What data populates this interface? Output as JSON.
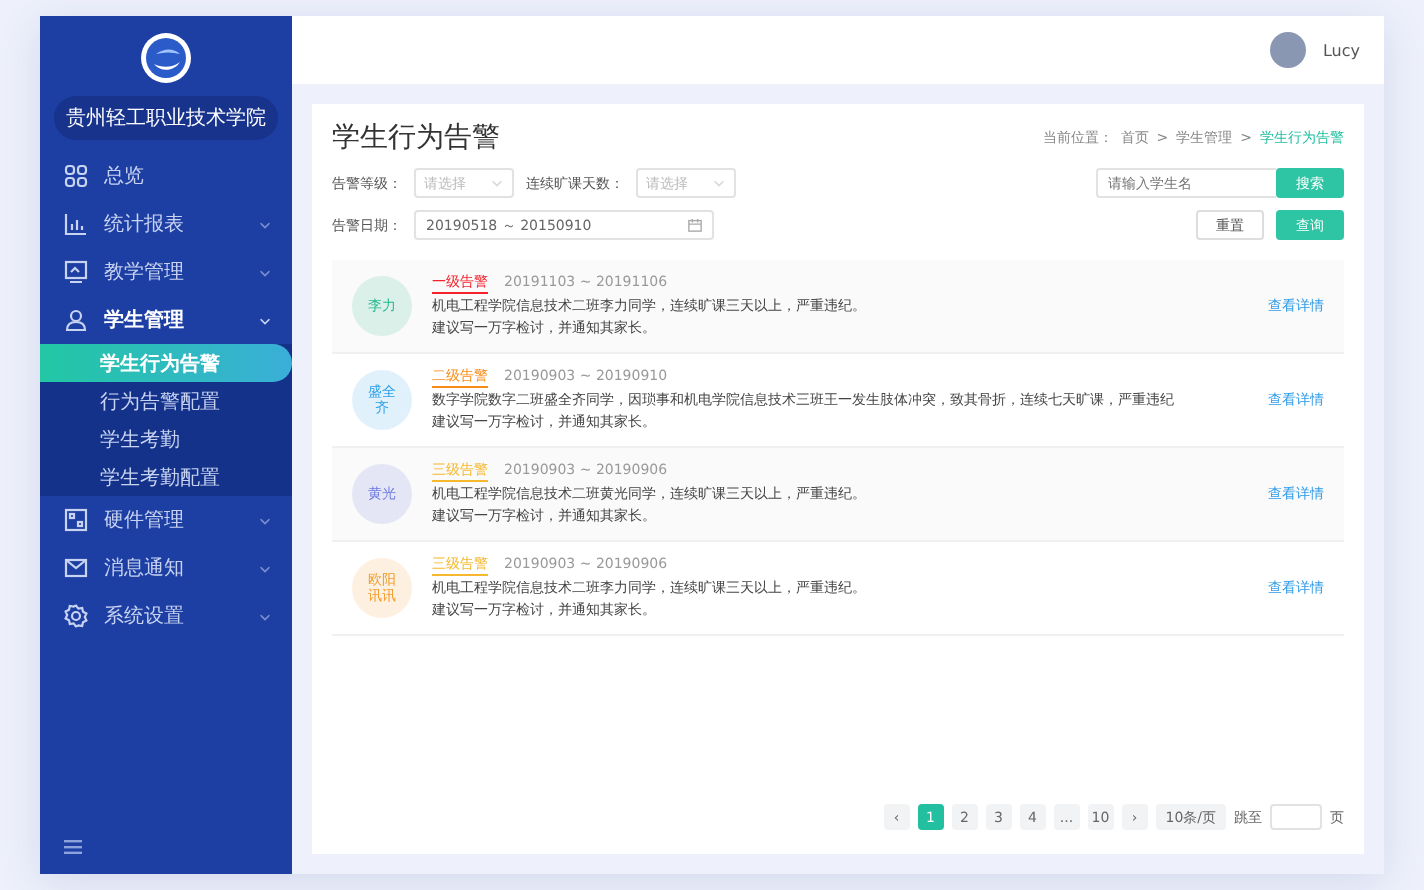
{
  "sidebar": {
    "school_name": "贵州轻工职业技术学院",
    "items": [
      {
        "label": "总览",
        "kind": "overview",
        "selected": false
      },
      {
        "label": "统计报表",
        "kind": "stats",
        "selected": false,
        "expanded": false
      },
      {
        "label": "教学管理",
        "kind": "teaching",
        "selected": false,
        "expanded": false
      },
      {
        "label": "学生管理",
        "kind": "students",
        "selected": false,
        "expanded": true,
        "children": [
          {
            "label": "学生行为告警",
            "selected": true
          },
          {
            "label": "行为告警配置",
            "selected": false
          },
          {
            "label": "学生考勤",
            "selected": false
          },
          {
            "label": "学生考勤配置",
            "selected": false
          }
        ]
      },
      {
        "label": "硬件管理",
        "kind": "hardware",
        "selected": false,
        "expanded": false
      },
      {
        "label": "消息通知",
        "kind": "messages",
        "selected": false,
        "expanded": false
      },
      {
        "label": "系统设置",
        "kind": "settings",
        "selected": false,
        "expanded": false
      }
    ]
  },
  "header": {
    "user_name": "Lucy"
  },
  "page": {
    "title": "学生行为告警",
    "breadcrumb": {
      "label": "当前位置：",
      "separator": ">",
      "items": [
        {
          "label": "首页",
          "selected": false
        },
        {
          "label": "学生管理",
          "selected": false
        },
        {
          "label": "学生行为告警",
          "selected": true
        }
      ]
    },
    "filters": {
      "level": {
        "label": "告警等级：",
        "placeholder": "请选择"
      },
      "days": {
        "label": "连续旷课天数：",
        "placeholder": "请选择"
      },
      "search": {
        "placeholder": "请输入学生名",
        "button": "搜索"
      },
      "date": {
        "label": "告警日期：",
        "value": "20190518 ～ 20150910"
      },
      "reset_button": "重置",
      "query_button": "查询"
    },
    "alerts": [
      {
        "name": "李力",
        "color": "#27b98f",
        "kind": "level1",
        "level_text": "一级告警",
        "dates": "20191103 ~ 20191106",
        "description": "机电工程学院信息技术二班李力同学，连续旷课三天以上，严重违纪。",
        "suggestion": "建议写一万字检讨，并通知其家长。",
        "link": "查看详情"
      },
      {
        "name": "盛全齐",
        "color": "#2ea0e8",
        "kind": "level2",
        "level_text": "二级告警",
        "dates": "20190903 ~ 20190910",
        "description": "数字学院数字二班盛全齐同学，因琐事和机电学院信息技术三班王一发生肢体冲突，致其骨折，连续七天旷课，严重违纪",
        "suggestion": "建议写一万字检讨，并通知其家长。",
        "link": "查看详情"
      },
      {
        "name": "黄光",
        "color": "#6b79e0",
        "kind": "level3",
        "level_text": "三级告警",
        "dates": "20190903 ~ 20190906",
        "description": "机电工程学院信息技术二班黄光同学，连续旷课三天以上，严重违纪。",
        "suggestion": "建议写一万字检讨，并通知其家长。",
        "link": "查看详情"
      },
      {
        "name": "欧阳讯讯",
        "color": "#f29b2c",
        "kind": "level3",
        "level_text": "三级告警",
        "dates": "20190903 ~ 20190906",
        "description": "机电工程学院信息技术二班李力同学，连续旷课三天以上，严重违纪。",
        "suggestion": "建议写一万字检讨，并通知其家长。",
        "link": "查看详情"
      }
    ],
    "pagination": {
      "prev": "‹",
      "next": "›",
      "pages": [
        {
          "label": "1",
          "selected": true
        },
        {
          "label": "2",
          "selected": false
        },
        {
          "label": "3",
          "selected": false
        },
        {
          "label": "4",
          "selected": false
        },
        {
          "label": "...",
          "selected": false
        },
        {
          "label": "10",
          "selected": false
        }
      ],
      "page_size": "10条/页",
      "jump_label": "跳至",
      "jump_suffix": "页"
    }
  }
}
